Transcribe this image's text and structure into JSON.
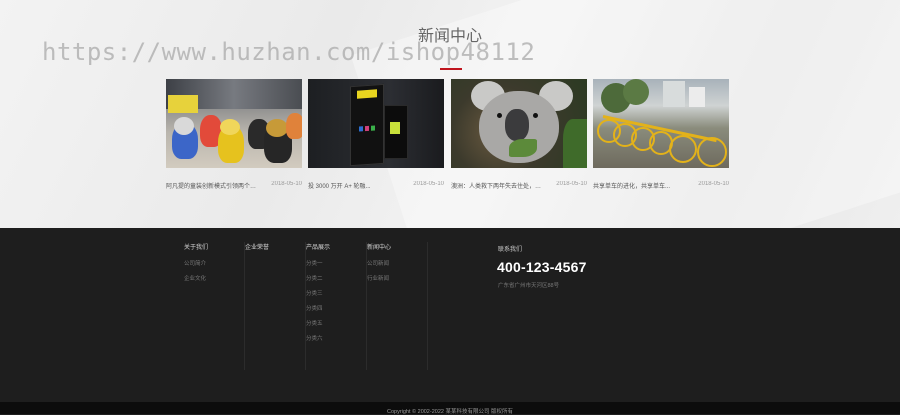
{
  "watermark": "https://www.huzhan.com/ishop48112",
  "news_section": {
    "title": "新闻中心",
    "accent_color": "#c0151e",
    "items": [
      {
        "headline": "阿凡提的童装创新模式引领两个领域下...",
        "date": "2018-05-10",
        "image": "figurines-photo"
      },
      {
        "headline": "投 3000 万开 A+ 轮融...",
        "date": "2018-05-10",
        "image": "device-box-photo"
      },
      {
        "headline": "澳洲：人类救下两年失去住处，考拉...",
        "date": "2018-05-10",
        "image": "koala-photo"
      },
      {
        "headline": "共享单车的进化，共享单车...",
        "date": "2018-05-10",
        "image": "shared-bikes-photo"
      }
    ]
  },
  "footer": {
    "columns": [
      {
        "heading": "关于我们",
        "links": [
          "公司简介",
          "企业文化"
        ]
      },
      {
        "heading": "企业荣誉",
        "links": []
      },
      {
        "heading": "产品展示",
        "links": [
          "分类一",
          "分类二",
          "分类三",
          "分类四",
          "分类五",
          "分类六"
        ]
      },
      {
        "heading": "新闻中心",
        "links": [
          "公司新闻",
          "行业新闻"
        ]
      }
    ],
    "contact": {
      "label": "联系我们",
      "phone": "400-123-4567",
      "address": "广东省广州市天河区88号"
    },
    "copyright": "Copyright © 2002-2022 某某科技有限公司 版权所有"
  }
}
